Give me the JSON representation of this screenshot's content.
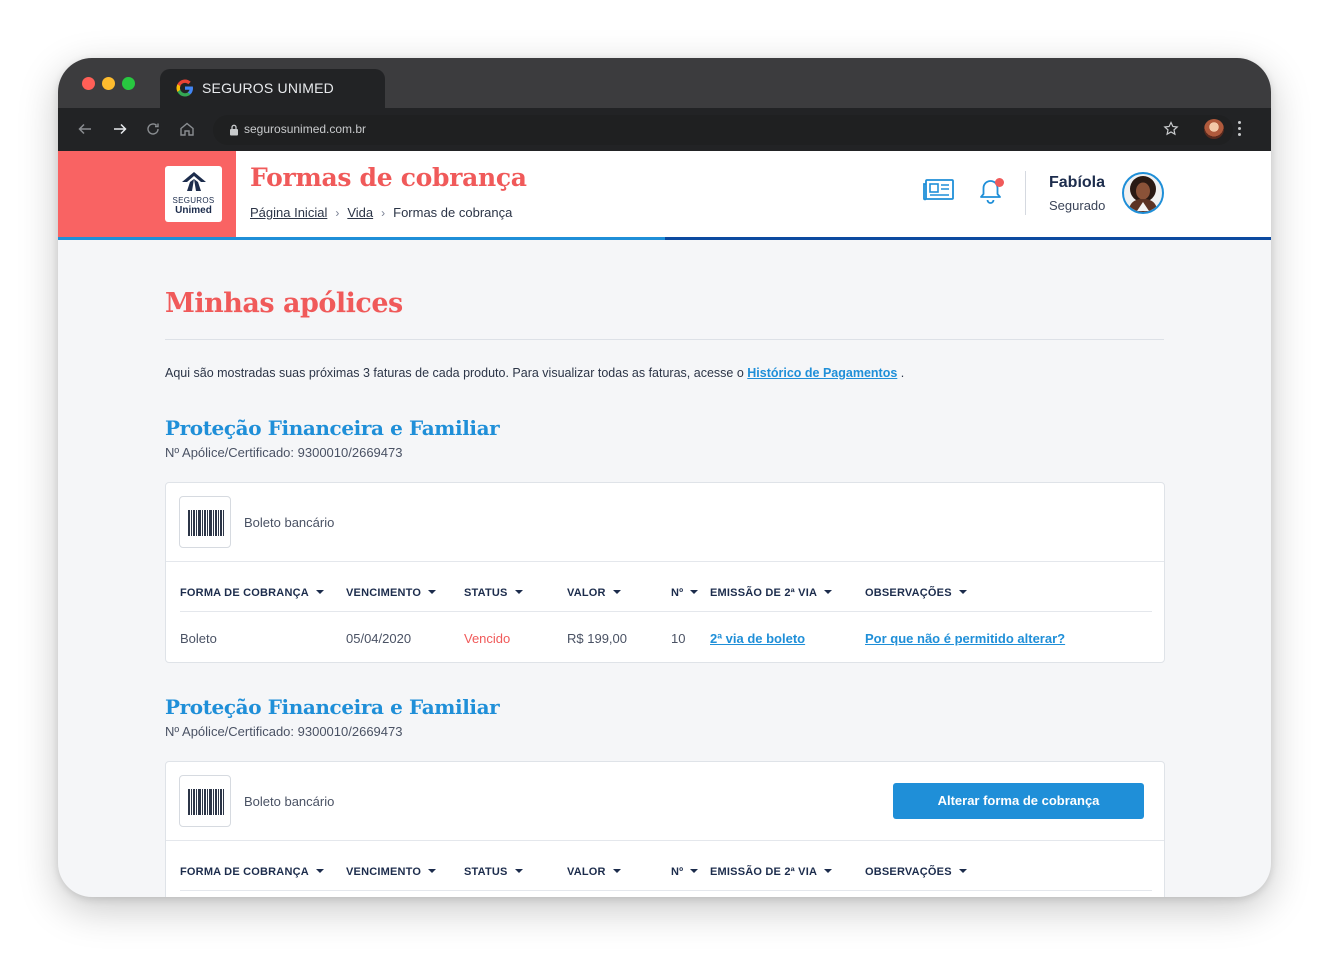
{
  "browser": {
    "tab_title": "SEGUROS UNIMED",
    "url": "segurosunimed.com.br"
  },
  "header": {
    "logo_line1": "SEGUROS",
    "logo_line2": "Unimed",
    "title": "Formas de cobrança",
    "breadcrumbs": [
      "Página Inicial",
      "Vida",
      "Formas de cobrança"
    ],
    "user_name": "Fabíola",
    "user_role": "Segurado",
    "progress_fraction": 0.5
  },
  "colors": {
    "brand_coral": "#f96363",
    "accent_blue": "#1f8fd8",
    "navy": "#1c2c4c",
    "status_overdue": "#f05a5a"
  },
  "main": {
    "section_title": "Minhas apólices",
    "intro_text": "Aqui são mostradas suas próximas 3 faturas de cada produto. Para visualizar todas as faturas, acesse o ",
    "intro_link": "Histórico de Pagamentos",
    "intro_end": " .",
    "table_headers": [
      "FORMA DE COBRANÇA",
      "VENCIMENTO",
      "STATUS",
      "VALOR",
      "Nº",
      "EMISSÃO DE 2ª VIA",
      "OBSERVAÇÕES"
    ],
    "policies": [
      {
        "title": "Proteção Financeira e Familiar",
        "number": "Nº Apólice/Certificado: 9300010/2669473",
        "payment_method": "Boleto bancário",
        "rows": [
          {
            "forma": "Boleto",
            "vencimento": "05/04/2020",
            "status": "Vencido",
            "valor": "R$ 199,00",
            "numero": "10",
            "emissao": "2ª via de boleto",
            "observacoes": "Por que não é permitido alterar?"
          }
        ]
      },
      {
        "title": "Proteção Financeira e Familiar",
        "number": "Nº Apólice/Certificado: 9300010/2669473",
        "payment_method": "Boleto bancário",
        "change_button": "Alterar forma de cobrança"
      }
    ]
  }
}
